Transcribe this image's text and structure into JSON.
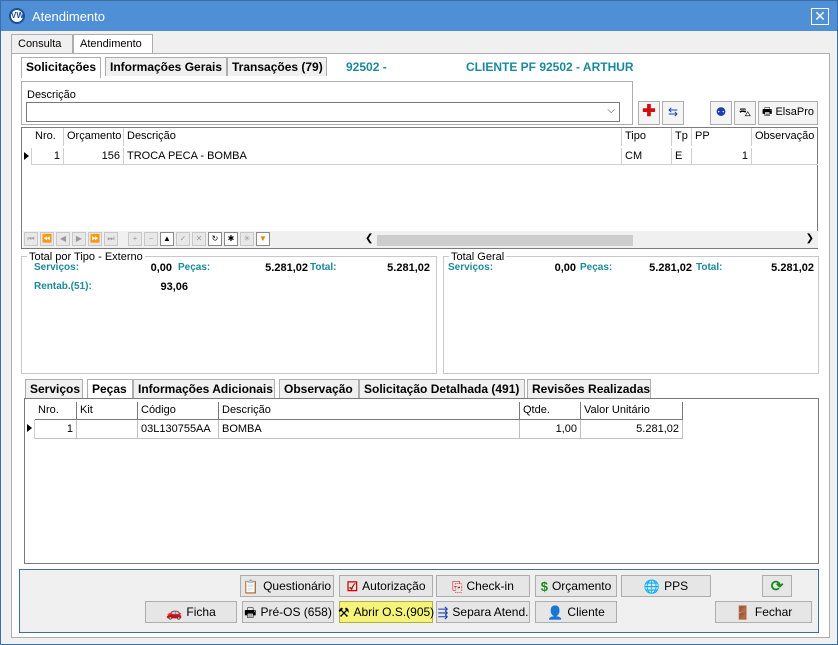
{
  "window": {
    "title": "Atendimento",
    "logo_icon": "vw-logo-icon",
    "close_icon": "close-icon"
  },
  "top_tabs": [
    "Consulta",
    "Atendimento"
  ],
  "sub_tabs": [
    "Solicitações",
    "Informações Gerais",
    "Transações (79)"
  ],
  "header_code": "92502 -",
  "header_client": "CLIENTE PF 92502 - ARTHUR",
  "description": {
    "label": "Descrição",
    "value": ""
  },
  "toolbar": {
    "elsapro_label": "ElsaPro"
  },
  "requests_grid": {
    "headers": [
      "Nro.",
      "Orçamento",
      "Descrição",
      "Tipo",
      "Tp",
      "PP",
      "Observação"
    ],
    "rows": [
      {
        "nro": "1",
        "orcamento": "156",
        "descricao": "TROCA PECA - BOMBA",
        "tipo": "CM",
        "tp": "E",
        "pp": "1",
        "obs": ""
      }
    ]
  },
  "total_tipo": {
    "title": "Total por Tipo - Externo",
    "servicos_label": "Serviços:",
    "servicos_value": "0,00",
    "pecas_label": "Peças:",
    "pecas_value": "5.281,02",
    "total_label": "Total:",
    "total_value": "5.281,02",
    "rentab_label": "Rentab.(51):",
    "rentab_value": "93,06"
  },
  "total_geral": {
    "title": "Total Geral",
    "servicos_label": "Serviços:",
    "servicos_value": "0,00",
    "pecas_label": "Peças:",
    "pecas_value": "5.281,02",
    "total_label": "Total:",
    "total_value": "5.281,02"
  },
  "bottom_tabs": [
    "Serviços",
    "Peças",
    "Informações Adicionais",
    "Observação",
    "Solicitação Detalhada (491)",
    "Revisões Realizadas"
  ],
  "parts_grid": {
    "headers": [
      "Nro.",
      "Kit",
      "Código",
      "Descrição",
      "Qtde.",
      "Valor Unitário"
    ],
    "rows": [
      {
        "nro": "1",
        "kit": "",
        "codigo": "03L130755AA",
        "descricao": "BOMBA",
        "qtde": "1,00",
        "valor": "5.281,02"
      }
    ]
  },
  "buttons": {
    "questionario": "Questionário",
    "autorizacao": "Autorização",
    "checkin": "Check-in",
    "orcamento": "Orçamento",
    "pps": "PPS",
    "ficha": "Ficha",
    "preos": "Pré-OS (658)",
    "abrir_os": "Abrir O.S.(905)",
    "separa": "Separa Atend.",
    "cliente": "Cliente",
    "fechar": "Fechar"
  },
  "colors": {
    "title_bar": "#4f8fd6",
    "label_teal": "#1a8a9a",
    "highlight_button": "#f5f37a"
  }
}
